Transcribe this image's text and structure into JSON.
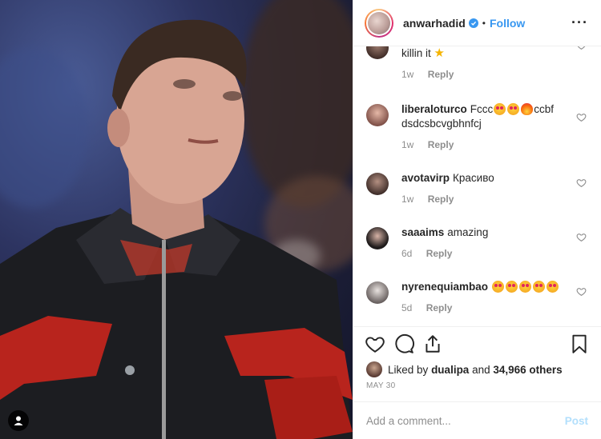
{
  "header": {
    "username": "anwarhadid",
    "separator": "•",
    "follow_label": "Follow",
    "more_label": "···"
  },
  "comments": [
    {
      "user": "",
      "text": "killin it",
      "emoji": "star",
      "time": "1w",
      "reply": "Reply"
    },
    {
      "user": "liberaloturco",
      "text_before": "Fccc",
      "text_after": "ccbf dsdcsbcvgbhnfcj",
      "time": "1w",
      "reply": "Reply"
    },
    {
      "user": "avotavirp",
      "text": "Красиво",
      "time": "1w",
      "reply": "Reply"
    },
    {
      "user": "saaaims",
      "text": "amazing",
      "time": "6d",
      "reply": "Reply"
    },
    {
      "user": "nyrenequiambao",
      "text": "",
      "time": "5d",
      "reply": "Reply"
    }
  ],
  "likes": {
    "prefix": "Liked by",
    "user": "dualipa",
    "middle": "and",
    "count": "34,966 others"
  },
  "post_date": "MAY 30",
  "add_comment": {
    "placeholder": "Add a comment...",
    "post_label": "Post"
  },
  "icons": {
    "like": "heart-icon",
    "comment": "comment-icon",
    "share": "share-icon",
    "save": "bookmark-icon",
    "user_tag": "user-tag-icon",
    "verified": "verified-badge-icon"
  },
  "colors": {
    "link_blue": "#3897f0",
    "post_disabled": "#b2dffc",
    "meta_gray": "#8e8e8e"
  }
}
